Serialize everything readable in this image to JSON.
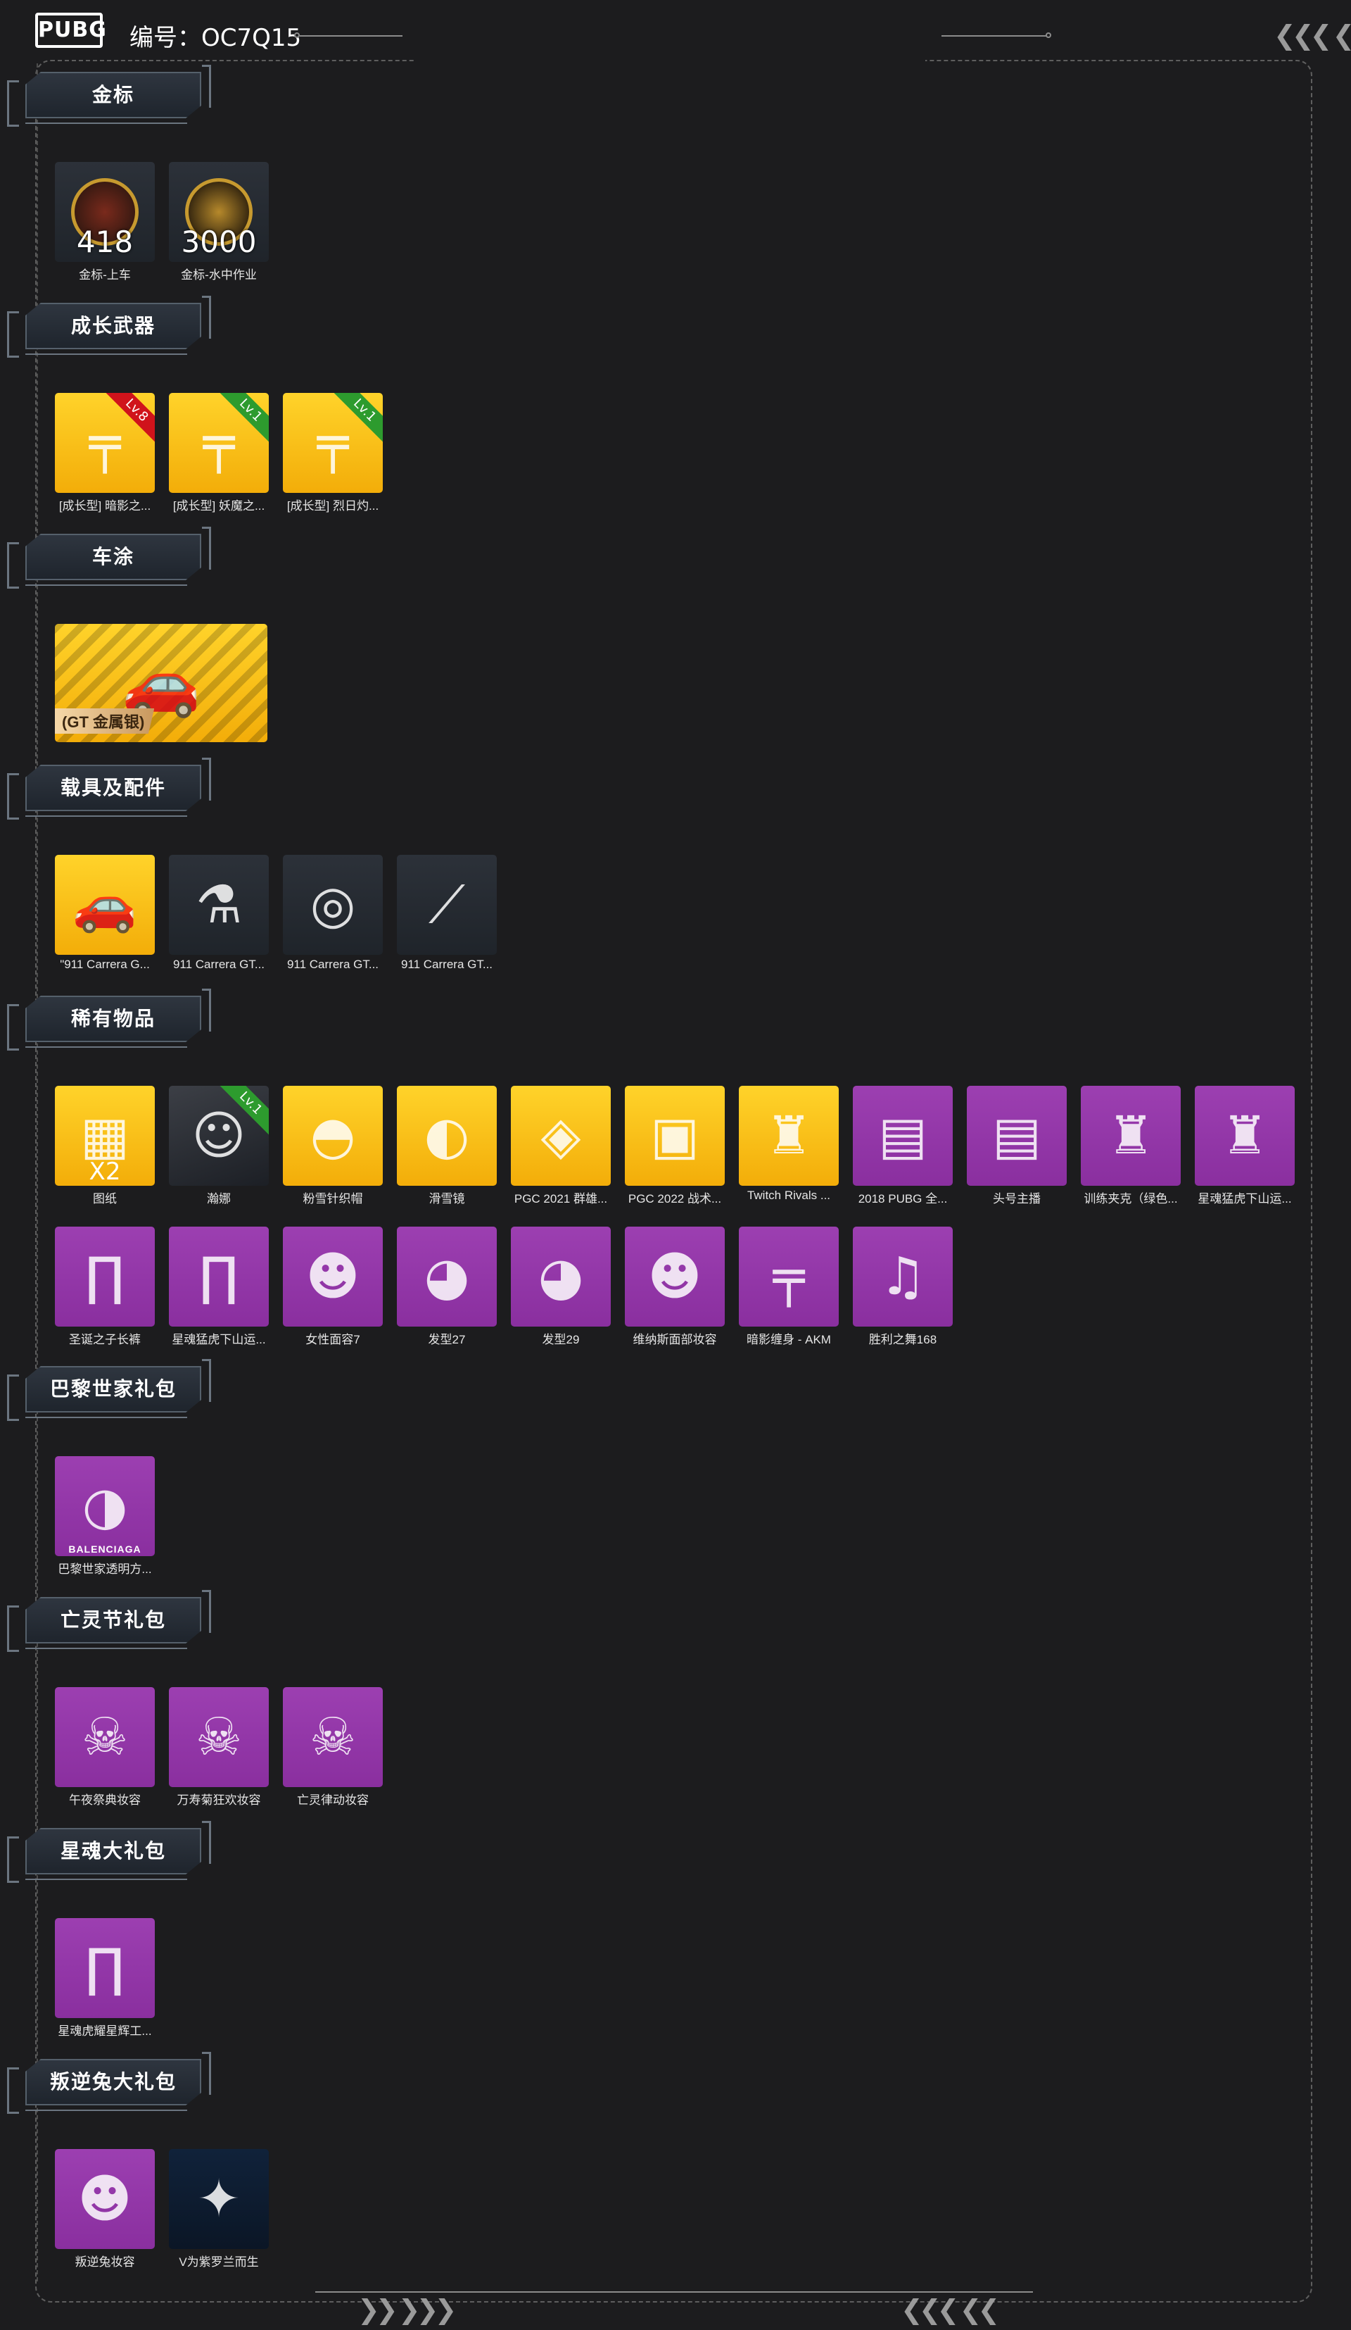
{
  "header": {
    "logo_text": "PUBG",
    "code_label": "编号：OC7Q15",
    "nav_arrows": "❮❮❮ ❮"
  },
  "footer": {
    "left_arrows": "❯❯ ❯❯❯",
    "right_arrows": "❮❮❮ ❮❮"
  },
  "sections": [
    {
      "title": "金标",
      "items": [
        {
          "label": "金标-上车",
          "tile": "dark",
          "number": "418",
          "icon": "medal-icon"
        },
        {
          "label": "金标-水中作业",
          "tile": "dark",
          "number": "3000",
          "icon": "medal-icon"
        }
      ]
    },
    {
      "title": "成长武器",
      "items": [
        {
          "label": "[成长型] 暗影之...",
          "tile": "gold",
          "level": "Lv.8",
          "level_color": "#d0131b",
          "icon": "rifle-icon"
        },
        {
          "label": "[成长型] 妖魔之...",
          "tile": "gold",
          "level": "Lv.1",
          "level_color": "#2d9b2e",
          "icon": "rifle-icon"
        },
        {
          "label": "[成长型] 烈日灼...",
          "tile": "gold",
          "level": "Lv.1",
          "level_color": "#2d9b2e",
          "icon": "shotgun-icon"
        }
      ]
    },
    {
      "title": "车涂",
      "items": [
        {
          "label": "",
          "tile": "gold-wide",
          "tag": "(GT 金属银)",
          "icon": "sports-car-icon"
        }
      ]
    },
    {
      "title": "载具及配件",
      "items": [
        {
          "label": "\"911 Carrera G...",
          "tile": "gold",
          "icon": "sports-car-icon"
        },
        {
          "label": "911 Carrera GT...",
          "tile": "dark",
          "icon": "spray-paint-icon"
        },
        {
          "label": "911 Carrera GT...",
          "tile": "dark",
          "icon": "wheel-icon"
        },
        {
          "label": "911 Carrera GT...",
          "tile": "dark",
          "icon": "car-part-icon"
        }
      ]
    },
    {
      "title": "稀有物品",
      "items": [
        {
          "label": "图纸",
          "tile": "gold",
          "sub": "X2",
          "icon": "blueprint-icon"
        },
        {
          "label": "瀚娜",
          "tile": "darkphoto",
          "level": "Lv.1",
          "level_color": "#2d9b2e",
          "icon": "character-icon"
        },
        {
          "label": "粉雪针织帽",
          "tile": "gold",
          "icon": "knit-hat-icon"
        },
        {
          "label": "滑雪镜",
          "tile": "gold",
          "icon": "goggles-icon"
        },
        {
          "label": "PGC 2021 群雄...",
          "tile": "gold",
          "icon": "mask-icon"
        },
        {
          "label": "PGC 2022 战术...",
          "tile": "gold",
          "icon": "vest-icon"
        },
        {
          "label": "Twitch Rivals ...",
          "tile": "gold",
          "icon": "jacket-icon"
        },
        {
          "label": "2018 PUBG 全...",
          "tile": "purple",
          "icon": "tshirt-icon"
        },
        {
          "label": "头号主播",
          "tile": "purple",
          "icon": "tshirt-icon"
        },
        {
          "label": "训练夹克（绿色...",
          "tile": "purple",
          "icon": "jacket-icon"
        },
        {
          "label": "星魂猛虎下山运...",
          "tile": "purple",
          "icon": "jacket-icon"
        },
        {
          "label": "圣诞之子长裤",
          "tile": "purple",
          "icon": "pants-icon"
        },
        {
          "label": "星魂猛虎下山运...",
          "tile": "purple",
          "icon": "pants-icon"
        },
        {
          "label": "女性面容7",
          "tile": "purple",
          "icon": "face-icon"
        },
        {
          "label": "发型27",
          "tile": "purple",
          "icon": "hair-icon"
        },
        {
          "label": "发型29",
          "tile": "purple",
          "icon": "hair-icon"
        },
        {
          "label": "维纳斯面部妆容",
          "tile": "purple",
          "icon": "face-icon"
        },
        {
          "label": "暗影缠身 - AKM",
          "tile": "purple",
          "icon": "rifle-icon"
        },
        {
          "label": "胜利之舞168",
          "tile": "purple",
          "icon": "dance-icon"
        }
      ]
    },
    {
      "title": "巴黎世家礼包",
      "items": [
        {
          "label": "巴黎世家透明方...",
          "tile": "purple",
          "sub": "BALENCIAGA",
          "icon": "sunglasses-icon"
        }
      ]
    },
    {
      "title": "亡灵节礼包",
      "items": [
        {
          "label": "午夜祭典妆容",
          "tile": "purple",
          "icon": "skull-face-icon"
        },
        {
          "label": "万寿菊狂欢妆容",
          "tile": "purple",
          "icon": "skull-face-icon"
        },
        {
          "label": "亡灵律动妆容",
          "tile": "purple",
          "icon": "skull-face-icon"
        }
      ]
    },
    {
      "title": "星魂大礼包",
      "items": [
        {
          "label": "星魂虎耀星辉工...",
          "tile": "purple",
          "icon": "pants-icon"
        }
      ]
    },
    {
      "title": "叛逆兔大礼包",
      "items": [
        {
          "label": "叛逆兔妆容",
          "tile": "purple",
          "icon": "face-icon"
        },
        {
          "label": "V为紫罗兰而生",
          "tile": "navy",
          "icon": "artwork-icon"
        }
      ]
    }
  ]
}
